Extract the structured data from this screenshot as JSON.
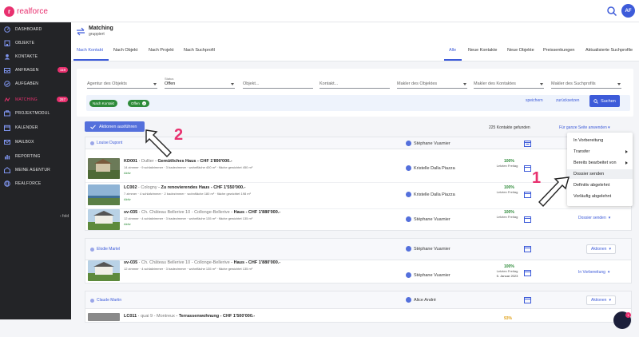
{
  "brand": {
    "name": "realforce",
    "accent": "#e8316f",
    "primary": "#3d5bd9"
  },
  "user": {
    "initials": "AF"
  },
  "sidebar": {
    "items": [
      {
        "label": "Dashboard",
        "icon": "dashboard-icon"
      },
      {
        "label": "Objekte",
        "icon": "building-icon"
      },
      {
        "label": "Kontakte",
        "icon": "contacts-icon"
      },
      {
        "label": "Anfragen",
        "icon": "inbox-icon",
        "badge": "118"
      },
      {
        "label": "Aufgaben",
        "icon": "tasks-icon"
      },
      {
        "label": "Matching",
        "icon": "matching-icon",
        "badge": "267",
        "active": true
      },
      {
        "label": "Projektmodul",
        "icon": "project-icon"
      },
      {
        "label": "Kalender",
        "icon": "calendar-icon"
      },
      {
        "label": "Mailbox",
        "icon": "mail-icon"
      },
      {
        "label": "Reporting",
        "icon": "chart-icon"
      },
      {
        "label": "Meine Agentur",
        "icon": "agency-icon"
      },
      {
        "label": "Realforce",
        "icon": "globe-icon"
      }
    ],
    "collapse_label": "‹ fold"
  },
  "header": {
    "title": "Matching",
    "subtitle": "gruppiert"
  },
  "tabs_left": [
    "Nach Kontakt",
    "Nach Objekt",
    "Nach Projekt",
    "Nach Suchprofil"
  ],
  "tabs_right": [
    "Alle",
    "Neue Kontakte",
    "Neue Objekte",
    "Preissenkungen",
    "Aktualisierte Suchprofile"
  ],
  "filters": {
    "agent_objekt": "Agentur des Objekts",
    "status_label": "Status",
    "status_value": "Offen",
    "objekt": "Objekt...",
    "kontakt": "Kontakt...",
    "makler_objekt": "Makler des Objektes",
    "makler_kontakt": "Makler des Kontaktes",
    "makler_suchprofil": "Makler des Suchprofils",
    "chips": [
      "Nach Kontakt",
      "Offen"
    ],
    "save": "speichern",
    "reset": "zurücksetzen",
    "search": "Suchen"
  },
  "toolbar": {
    "actions_label": "Aktionen ausführen",
    "found": "225 Kontakte gefunden",
    "apply_all": "Für ganze Seite anwenden"
  },
  "groups": [
    {
      "contact": "Louise Dupont",
      "agent": "Stéphane Vuarnier",
      "rows": [
        {
          "ref": "KD001",
          "loc": "Dullier",
          "title": "Gemütliches Haus - CHF 1'890'000.-",
          "specs": "14 zimmer · 9 schlafzimmer · 3 badezimmer · wohnfläche 400 m² · fläche gewichtet 450 m²",
          "status": "Aktiv",
          "agent": "Kristelle Dalla Piazza",
          "pct": "100%",
          "date_label": "Letzten Freitag"
        },
        {
          "ref": "LC002",
          "loc": "Cologny",
          "title": "Zu renovierendes Haus - CHF 1'550'000.-",
          "specs": "7 zimmer · 4 schlafzimmer · 2 badezimmer · wohnfläche 180 m² · fläche gewichtet 198 m²",
          "status": "Aktiv",
          "agent": "Kristelle Dalla Piazza",
          "pct": "100%",
          "date_label": "Letzten Freitag"
        },
        {
          "ref": "sv-035",
          "loc": "Ch. Château Bellerive 10 - Collonge-Bellerive",
          "title": "Haus - CHF 1'880'000.-",
          "specs": "12 zimmer · 4 schlafzimmer · 3 badezimmer · wohnfläche 135 m² · fläche gewichtet 135 m²",
          "status": "Aktiv",
          "agent": "Stéphane Vuarnier",
          "pct": "100%",
          "date_label": "Letzten Freitag",
          "action": "Dossier senden"
        }
      ]
    },
    {
      "contact": "Elodie Martel",
      "agent": "Stéphane Vuarnier",
      "group_action": "Aktionen",
      "rows": [
        {
          "ref": "sv-035",
          "loc": "Ch. Château Bellerive 10 - Collonge-Bellerive",
          "title": "Haus - CHF 1'880'000.-",
          "specs": "12 zimmer · 4 schlafzimmer · 3 badezimmer · wohnfläche 135 m² · fläche gewichtet 135 m²",
          "status": "",
          "agent": "Stéphane Vuarnier",
          "pct": "100%",
          "date_label": "Letzten Freitag",
          "date": "5. Januar 2023",
          "action": "In Vorbereitung"
        }
      ]
    },
    {
      "contact": "Claude Martin",
      "agent": "Alice André",
      "group_action": "Aktionen",
      "rows": [
        {
          "ref": "LC011",
          "loc": "quai 9 - Montreux",
          "title": "Terrassenwohnung - CHF 1'500'000.-",
          "specs": "",
          "status": "",
          "agent": "",
          "pct": "93%",
          "date_label": ""
        }
      ]
    }
  ],
  "menu": {
    "items": [
      "In Vorbereitung",
      "Transfer",
      "Bereits bearbeitet von",
      "Dossier senden",
      "Definitiv abgelehnt",
      "Vorläufig abgelehnt"
    ]
  },
  "annotations": [
    "1",
    "2"
  ],
  "chat": {
    "badge": "1"
  }
}
